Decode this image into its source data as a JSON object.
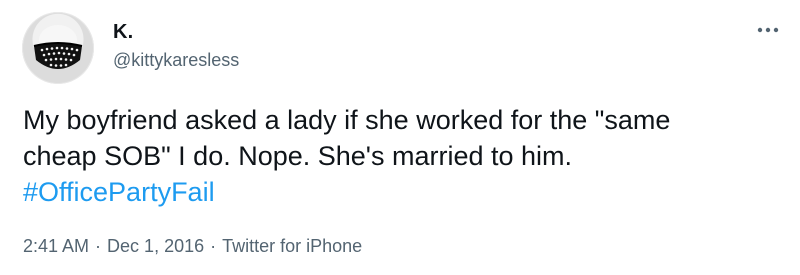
{
  "tweet": {
    "display_name": "K.",
    "handle": "@kittykaresless",
    "body_line1": "My boyfriend asked a lady if she worked for the \"same",
    "body_line2": "cheap SOB\" I do. Nope. She's married to him.",
    "hashtag": "#OfficePartyFail",
    "time": "2:41 AM",
    "separator": "·",
    "date": "Dec 1, 2016",
    "source": "Twitter for iPhone"
  },
  "icons": {
    "avatar": "avatar-image",
    "more": "more-options-icon"
  },
  "colors": {
    "text": "#0f1419",
    "secondary": "#536471",
    "link": "#1d9bf0",
    "background": "#ffffff"
  }
}
